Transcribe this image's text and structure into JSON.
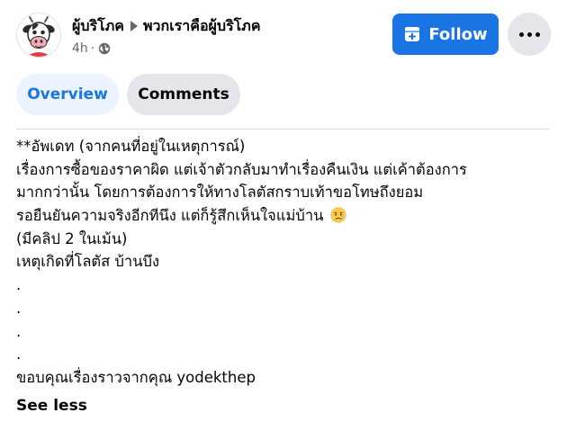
{
  "post_header": {
    "author": "ผู้บริโภค",
    "group": "พวกเราคือผู้บริโภค",
    "time": "4h",
    "separator": "·",
    "visibility_icon": "globe-icon"
  },
  "actions": {
    "follow_label": "Follow",
    "follow_icon": "follow-plus-icon",
    "more_icon": "more-horizontal-icon"
  },
  "tabs": [
    {
      "label": "Overview",
      "selected": true
    },
    {
      "label": "Comments",
      "selected": false
    }
  ],
  "post_body": {
    "lines": [
      "**อัพเดท (จากคนที่อยู่ในเหตุการณ์)",
      "เรื่องการซื้อของราคาผิด แต่เจ้าตัวกลับมาทำเรื่องคืนเงิน แต่เค้าต้องการ",
      "มากกว่านั้น โดยการต้องการให้ทางโลตัสกราบเท้าขอโทษถึงยอม",
      "รอยืนยันความจริงอีกทีนึง แต่ก็รู้สึกเห็นใจแม่บ้าน",
      "(มีคลิป 2 ในเม้น)",
      "เหตุเกิดที่โลตัส บ้านบึง",
      ".",
      ".",
      ".",
      ".",
      "ขอบคุณเรื่องราวจากคุณ yodekthep"
    ],
    "emoji": "sad-relieved-face-emoji",
    "see_less_label": "See less"
  },
  "colors": {
    "brand_blue": "#1b74e4",
    "tab_selected_bg": "#eaf3ff",
    "button_gray": "#e4e6eb",
    "secondary_text": "#65676b"
  }
}
